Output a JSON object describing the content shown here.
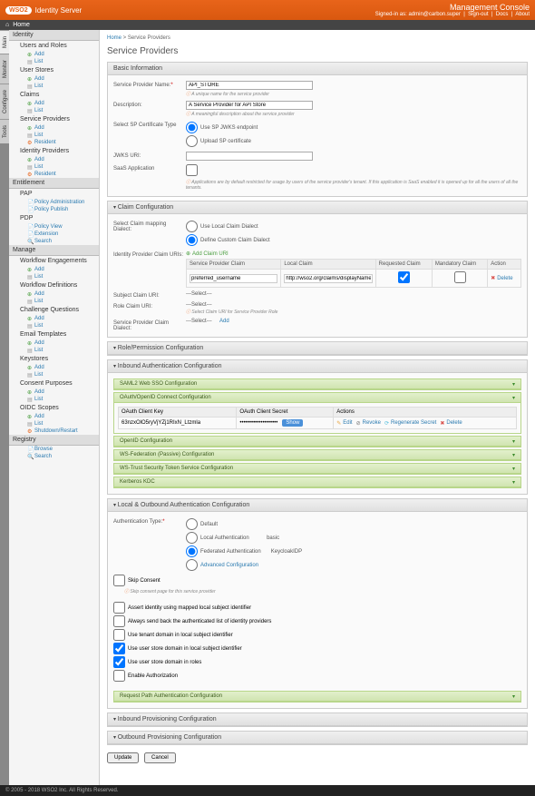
{
  "header": {
    "product": "Identity Server",
    "brand": "WSO2",
    "console_title": "Management Console",
    "signed_in_prefix": "Signed-in as:",
    "user": "admin@carbon.super",
    "links": {
      "signout": "Sign-out",
      "docs": "Docs",
      "about": "About"
    }
  },
  "topbar": {
    "home": "Home"
  },
  "left_tabs": [
    "Main",
    "Monitor",
    "Configure",
    "Tools"
  ],
  "sidebar": {
    "sections": [
      {
        "title": "Identity",
        "groups": [
          {
            "label": "Users and Roles",
            "items": [
              {
                "i": "add",
                "t": "Add"
              },
              {
                "i": "list",
                "t": "List"
              }
            ]
          },
          {
            "label": "User Stores",
            "items": [
              {
                "i": "add",
                "t": "Add"
              },
              {
                "i": "list",
                "t": "List"
              }
            ]
          },
          {
            "label": "Claims",
            "items": [
              {
                "i": "add",
                "t": "Add"
              },
              {
                "i": "list",
                "t": "List"
              }
            ]
          },
          {
            "label": "Service Providers",
            "items": [
              {
                "i": "add",
                "t": "Add"
              },
              {
                "i": "list",
                "t": "List"
              },
              {
                "i": "res",
                "t": "Resident"
              }
            ]
          },
          {
            "label": "Identity Providers",
            "items": [
              {
                "i": "add",
                "t": "Add"
              },
              {
                "i": "list",
                "t": "List"
              },
              {
                "i": "res",
                "t": "Resident"
              }
            ]
          }
        ]
      },
      {
        "title": "Entitlement",
        "groups": [
          {
            "label": "PAP",
            "items": [
              {
                "i": "doc",
                "t": "Policy Administration"
              },
              {
                "i": "doc",
                "t": "Policy Publish"
              }
            ]
          },
          {
            "label": "PDP",
            "items": [
              {
                "i": "doc",
                "t": "Policy View"
              },
              {
                "i": "doc",
                "t": "Extension"
              },
              {
                "i": "search",
                "t": "Search"
              }
            ]
          }
        ]
      },
      {
        "title": "Manage",
        "groups": [
          {
            "label": "Workflow Engagements",
            "items": [
              {
                "i": "add",
                "t": "Add"
              },
              {
                "i": "list",
                "t": "List"
              }
            ]
          },
          {
            "label": "Workflow Definitions",
            "items": [
              {
                "i": "add",
                "t": "Add"
              },
              {
                "i": "list",
                "t": "List"
              }
            ]
          },
          {
            "label": "Challenge Questions",
            "items": [
              {
                "i": "add",
                "t": "Add"
              },
              {
                "i": "list",
                "t": "List"
              }
            ]
          },
          {
            "label": "Email Templates",
            "items": [
              {
                "i": "add",
                "t": "Add"
              },
              {
                "i": "list",
                "t": "List"
              }
            ]
          },
          {
            "label": "Keystores",
            "items": [
              {
                "i": "add",
                "t": "Add"
              },
              {
                "i": "list",
                "t": "List"
              }
            ]
          },
          {
            "label": "Consent Purposes",
            "items": [
              {
                "i": "add",
                "t": "Add"
              },
              {
                "i": "list",
                "t": "List"
              }
            ]
          },
          {
            "label": "OIDC Scopes",
            "items": [
              {
                "i": "add",
                "t": "Add"
              },
              {
                "i": "list",
                "t": "List"
              }
            ]
          },
          {
            "label": "",
            "items": [
              {
                "i": "res",
                "t": "Shutdown/Restart"
              }
            ]
          }
        ]
      },
      {
        "title": "Registry",
        "groups": [
          {
            "label": "",
            "items": [
              {
                "i": "doc",
                "t": "Browse"
              },
              {
                "i": "search",
                "t": "Search"
              }
            ]
          }
        ]
      }
    ]
  },
  "breadcrumb": {
    "home": "Home",
    "current": "Service Providers"
  },
  "page": {
    "title": "Service Providers"
  },
  "basic": {
    "panel": "Basic Information",
    "name_label": "Service Provider Name:",
    "name_value": "API_STORE",
    "name_hint": "A unique name for the service provider",
    "desc_label": "Description:",
    "desc_value": "A Service Provider for API Store",
    "desc_hint": "A meaningful description about the service provider",
    "cert_label": "Select SP Certificate Type",
    "cert_opt1": "Use SP JWKS endpoint",
    "cert_opt2": "Upload SP certificate",
    "jwks_label": "JWKS URI:",
    "saas_label": "SaaS Application",
    "saas_hint": "Applications are by default restricted for usage by users of the service provider's tenant. If this application is SaaS enabled it is opened up for all the users of all the tenants."
  },
  "claim": {
    "panel": "Claim Configuration",
    "dialect_label": "Select Claim mapping Dialect:",
    "dialect_opt1": "Use Local Claim Dialect",
    "dialect_opt2": "Define Custom Claim Dialect",
    "idp_label": "Identity Provider Claim URIs:",
    "add_claim": "Add Claim URI",
    "th1": "Service Provider Claim",
    "th2": "Local Claim",
    "th3": "Requested Claim",
    "th4": "Mandatory Claim",
    "th5": "Action",
    "row_sp": "preferred_username",
    "row_local": "http://wso2.org/claims/displayName",
    "delete": "Delete",
    "subject_label": "Subject Claim URI:",
    "select_placeholder": "---Select---",
    "role_label": "Role Claim URI:",
    "role_hint": "Select Claim URI for Service Provider Role",
    "sp_dialect_label": "Service Provider Claim Dialect:",
    "add": "Add"
  },
  "roleperm": {
    "panel": "Role/Permission Configuration"
  },
  "inbound": {
    "panel": "Inbound Authentication Configuration",
    "saml": "SAML2 Web SSO Configuration",
    "oauth": "OAuth/OpenID Connect Configuration",
    "th_key": "OAuth Client Key",
    "th_secret": "OAuth Client Secret",
    "th_actions": "Actions",
    "key_val": "63nzxOlO5ryVjYZj1RIxN_Ltzmla",
    "secret_val": "••••••••••••••••••••",
    "show": "Show",
    "edit": "Edit",
    "revoke": "Revoke",
    "regen": "Regenerate Secret",
    "delete": "Delete",
    "openid": "OpenID Configuration",
    "wsfed": "WS-Federation (Passive) Configuration",
    "wstrust": "WS-Trust Security Token Service Configuration",
    "kerberos": "Kerberos KDC"
  },
  "localout": {
    "panel": "Local & Outbound Authentication Configuration",
    "type_label": "Authentication Type:",
    "opt_default": "Default",
    "opt_local": "Local Authentication",
    "local_val": "basic",
    "opt_fed": "Federated Authentication",
    "fed_val": "KeycloakIDP",
    "opt_adv": "Advanced Configuration",
    "skip_consent": "Skip Consent",
    "skip_hint": "Skip consent page for this service provider",
    "c1": "Assert identity using mapped local subject identifier",
    "c2": "Always send back the authenticated list of identity providers",
    "c3": "Use tenant domain in local subject identifier",
    "c4": "Use user store domain in local subject identifier",
    "c5": "Use user store domain in roles",
    "c6": "Enable Authorization",
    "reqpath": "Request Path Authentication Configuration"
  },
  "inprov": {
    "panel": "Inbound Provisioning Configuration"
  },
  "outprov": {
    "panel": "Outbound Provisioning Configuration"
  },
  "buttons": {
    "update": "Update",
    "cancel": "Cancel"
  },
  "footer": "© 2005 - 2018 WSO2 Inc. All Rights Reserved."
}
